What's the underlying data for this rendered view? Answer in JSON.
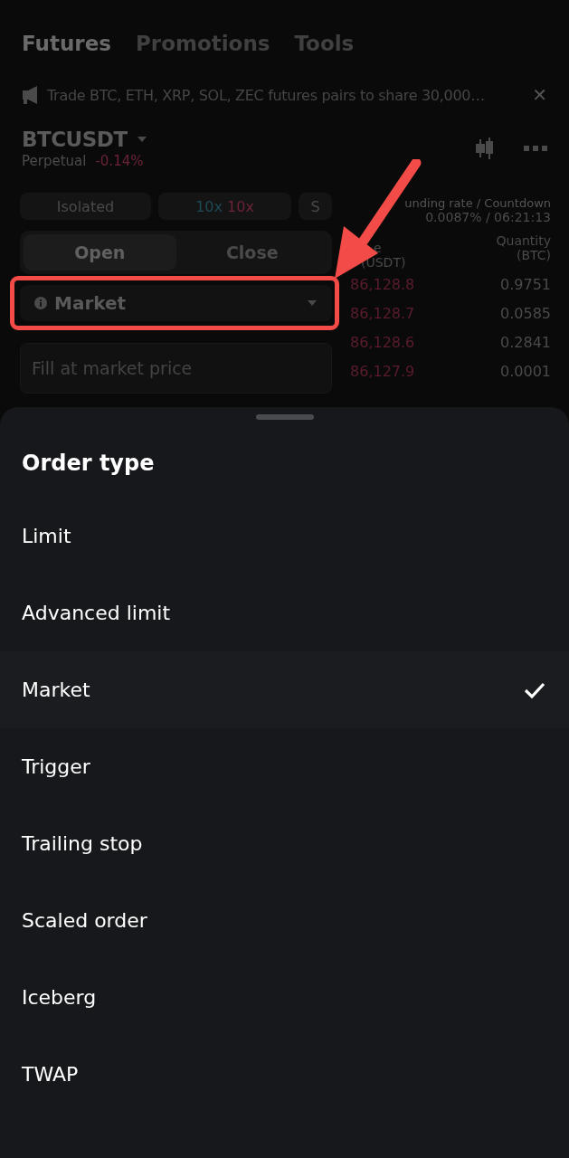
{
  "nav_tabs": [
    {
      "label": "Futures",
      "selected": true
    },
    {
      "label": "Promotions",
      "selected": false
    },
    {
      "label": "Tools",
      "selected": false
    }
  ],
  "banner": {
    "text": "Trade BTC, ETH, XRP, SOL, ZEC futures pairs to share 30,000…",
    "close": "✕"
  },
  "ticker": {
    "symbol": "BTCUSDT",
    "type": "Perpetual",
    "change": "-0.14%"
  },
  "controls": {
    "margin_mode": "Isolated",
    "leverage_long": "10x",
    "leverage_short": "10x",
    "side": "S"
  },
  "position_tabs": [
    {
      "label": "Open",
      "selected": true
    },
    {
      "label": "Close",
      "selected": false
    }
  ],
  "order_select": {
    "value": "Market",
    "highlighted": true
  },
  "price_field": {
    "placeholder": "Fill at market price"
  },
  "funding": {
    "label": "unding rate / Countdown",
    "value": "0.0087% / 06:21:13"
  },
  "book": {
    "price_header": [
      "e",
      "(USDT)"
    ],
    "quantity_header": [
      "Quantity",
      "(BTC)"
    ],
    "rows": [
      {
        "price": "86,128.8",
        "quantity": "0.9751"
      },
      {
        "price": "86,128.7",
        "quantity": "0.0585"
      },
      {
        "price": "86,128.6",
        "quantity": "0.2841"
      },
      {
        "price": "86,127.9",
        "quantity": "0.0001"
      }
    ]
  },
  "sheet": {
    "title": "Order type",
    "options": [
      {
        "label": "Limit",
        "selected": false
      },
      {
        "label": "Advanced limit",
        "selected": false
      },
      {
        "label": "Market",
        "selected": true
      },
      {
        "label": "Trigger",
        "selected": false
      },
      {
        "label": "Trailing stop",
        "selected": false
      },
      {
        "label": "Scaled order",
        "selected": false
      },
      {
        "label": "Iceberg",
        "selected": false
      },
      {
        "label": "TWAP",
        "selected": false
      }
    ]
  }
}
